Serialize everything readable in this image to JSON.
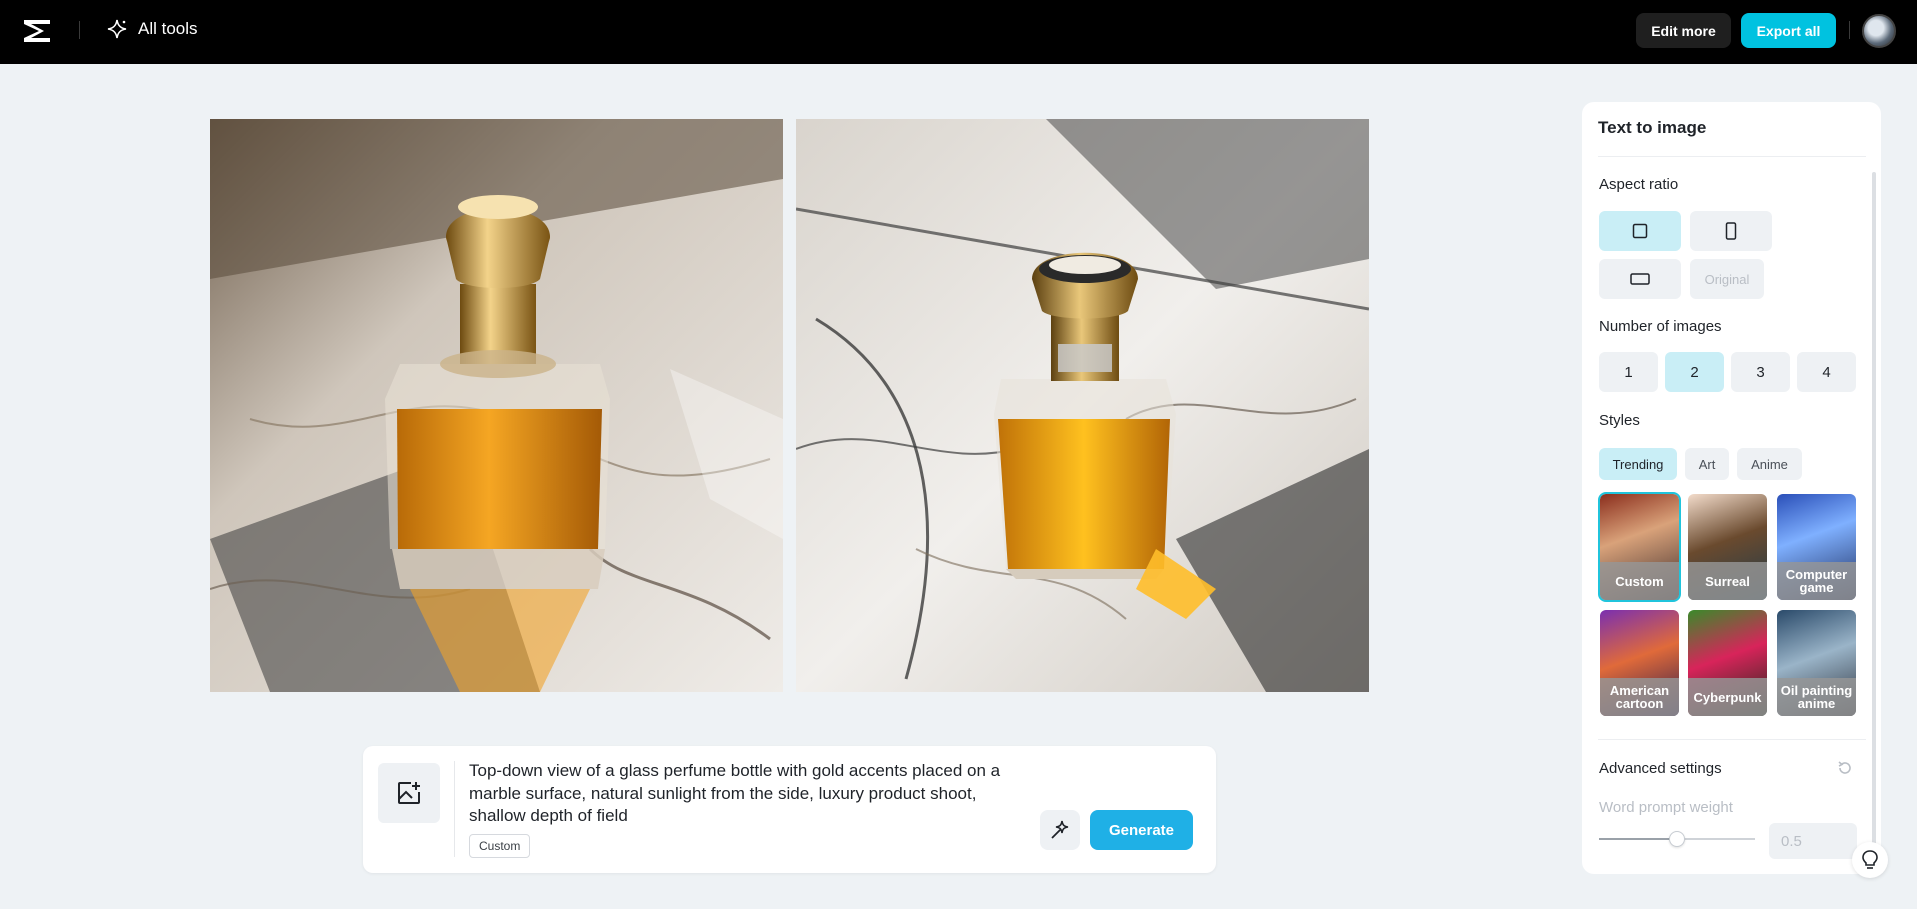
{
  "topbar": {
    "all_tools_label": "All tools",
    "edit_more_label": "Edit more",
    "export_all_label": "Export all",
    "icons": [
      "capcut-logo-icon",
      "sparkle-icon",
      "avatar"
    ]
  },
  "canvas": {
    "images": [
      {
        "description_icon": "perfume-bottle-image"
      },
      {
        "description_icon": "perfume-bottle-image"
      }
    ]
  },
  "prompt": {
    "text": "Top-down view of a glass perfume bottle with gold accents placed on a marble surface, natural sunlight from the side, luxury product shoot, shallow depth of field",
    "style_tag": "Custom",
    "generate_label": "Generate",
    "icons": [
      "add-image-icon",
      "magic-wand-icon"
    ]
  },
  "panel": {
    "title": "Text to image",
    "aspect_ratio": {
      "label": "Aspect ratio",
      "options": [
        "square",
        "portrait",
        "landscape",
        "Original"
      ],
      "selected": "square",
      "original_label": "Original"
    },
    "num_images": {
      "label": "Number of images",
      "options": [
        "1",
        "2",
        "3",
        "4"
      ],
      "selected": "2"
    },
    "styles": {
      "label": "Styles",
      "tabs": [
        "Trending",
        "Art",
        "Anime"
      ],
      "selected_tab": "Trending",
      "tiles": [
        "Custom",
        "Surreal",
        "Computer game",
        "American cartoon",
        "Cyberpunk",
        "Oil painting anime"
      ],
      "selected_tile": "Custom"
    },
    "advanced": {
      "label": "Advanced settings",
      "word_prompt_weight_label": "Word prompt weight",
      "word_prompt_weight_value": "0.5"
    }
  },
  "colors": {
    "accent": "#00c2e0",
    "generate": "#1fb0e6",
    "selected_bg": "#c9eef6",
    "page_bg": "#eef2f5"
  }
}
